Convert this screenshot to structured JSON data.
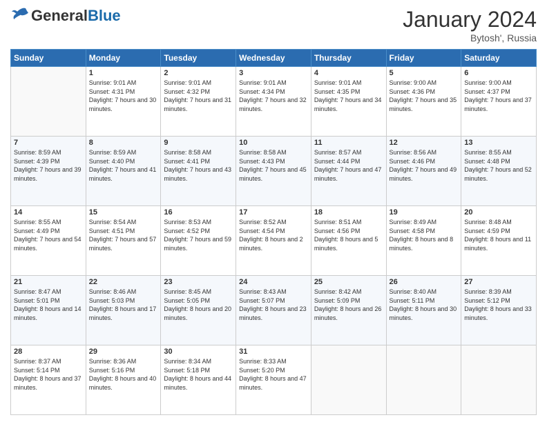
{
  "header": {
    "logo_general": "General",
    "logo_blue": "Blue",
    "month_year": "January 2024",
    "location": "Bytosh', Russia"
  },
  "weekdays": [
    "Sunday",
    "Monday",
    "Tuesday",
    "Wednesday",
    "Thursday",
    "Friday",
    "Saturday"
  ],
  "weeks": [
    [
      {
        "day": "",
        "sunrise": "",
        "sunset": "",
        "daylight": ""
      },
      {
        "day": "1",
        "sunrise": "9:01 AM",
        "sunset": "4:31 PM",
        "daylight": "7 hours and 30 minutes."
      },
      {
        "day": "2",
        "sunrise": "9:01 AM",
        "sunset": "4:32 PM",
        "daylight": "7 hours and 31 minutes."
      },
      {
        "day": "3",
        "sunrise": "9:01 AM",
        "sunset": "4:34 PM",
        "daylight": "7 hours and 32 minutes."
      },
      {
        "day": "4",
        "sunrise": "9:01 AM",
        "sunset": "4:35 PM",
        "daylight": "7 hours and 34 minutes."
      },
      {
        "day": "5",
        "sunrise": "9:00 AM",
        "sunset": "4:36 PM",
        "daylight": "7 hours and 35 minutes."
      },
      {
        "day": "6",
        "sunrise": "9:00 AM",
        "sunset": "4:37 PM",
        "daylight": "7 hours and 37 minutes."
      }
    ],
    [
      {
        "day": "7",
        "sunrise": "8:59 AM",
        "sunset": "4:39 PM",
        "daylight": "7 hours and 39 minutes."
      },
      {
        "day": "8",
        "sunrise": "8:59 AM",
        "sunset": "4:40 PM",
        "daylight": "7 hours and 41 minutes."
      },
      {
        "day": "9",
        "sunrise": "8:58 AM",
        "sunset": "4:41 PM",
        "daylight": "7 hours and 43 minutes."
      },
      {
        "day": "10",
        "sunrise": "8:58 AM",
        "sunset": "4:43 PM",
        "daylight": "7 hours and 45 minutes."
      },
      {
        "day": "11",
        "sunrise": "8:57 AM",
        "sunset": "4:44 PM",
        "daylight": "7 hours and 47 minutes."
      },
      {
        "day": "12",
        "sunrise": "8:56 AM",
        "sunset": "4:46 PM",
        "daylight": "7 hours and 49 minutes."
      },
      {
        "day": "13",
        "sunrise": "8:55 AM",
        "sunset": "4:48 PM",
        "daylight": "7 hours and 52 minutes."
      }
    ],
    [
      {
        "day": "14",
        "sunrise": "8:55 AM",
        "sunset": "4:49 PM",
        "daylight": "7 hours and 54 minutes."
      },
      {
        "day": "15",
        "sunrise": "8:54 AM",
        "sunset": "4:51 PM",
        "daylight": "7 hours and 57 minutes."
      },
      {
        "day": "16",
        "sunrise": "8:53 AM",
        "sunset": "4:52 PM",
        "daylight": "7 hours and 59 minutes."
      },
      {
        "day": "17",
        "sunrise": "8:52 AM",
        "sunset": "4:54 PM",
        "daylight": "8 hours and 2 minutes."
      },
      {
        "day": "18",
        "sunrise": "8:51 AM",
        "sunset": "4:56 PM",
        "daylight": "8 hours and 5 minutes."
      },
      {
        "day": "19",
        "sunrise": "8:49 AM",
        "sunset": "4:58 PM",
        "daylight": "8 hours and 8 minutes."
      },
      {
        "day": "20",
        "sunrise": "8:48 AM",
        "sunset": "4:59 PM",
        "daylight": "8 hours and 11 minutes."
      }
    ],
    [
      {
        "day": "21",
        "sunrise": "8:47 AM",
        "sunset": "5:01 PM",
        "daylight": "8 hours and 14 minutes."
      },
      {
        "day": "22",
        "sunrise": "8:46 AM",
        "sunset": "5:03 PM",
        "daylight": "8 hours and 17 minutes."
      },
      {
        "day": "23",
        "sunrise": "8:45 AM",
        "sunset": "5:05 PM",
        "daylight": "8 hours and 20 minutes."
      },
      {
        "day": "24",
        "sunrise": "8:43 AM",
        "sunset": "5:07 PM",
        "daylight": "8 hours and 23 minutes."
      },
      {
        "day": "25",
        "sunrise": "8:42 AM",
        "sunset": "5:09 PM",
        "daylight": "8 hours and 26 minutes."
      },
      {
        "day": "26",
        "sunrise": "8:40 AM",
        "sunset": "5:11 PM",
        "daylight": "8 hours and 30 minutes."
      },
      {
        "day": "27",
        "sunrise": "8:39 AM",
        "sunset": "5:12 PM",
        "daylight": "8 hours and 33 minutes."
      }
    ],
    [
      {
        "day": "28",
        "sunrise": "8:37 AM",
        "sunset": "5:14 PM",
        "daylight": "8 hours and 37 minutes."
      },
      {
        "day": "29",
        "sunrise": "8:36 AM",
        "sunset": "5:16 PM",
        "daylight": "8 hours and 40 minutes."
      },
      {
        "day": "30",
        "sunrise": "8:34 AM",
        "sunset": "5:18 PM",
        "daylight": "8 hours and 44 minutes."
      },
      {
        "day": "31",
        "sunrise": "8:33 AM",
        "sunset": "5:20 PM",
        "daylight": "8 hours and 47 minutes."
      },
      {
        "day": "",
        "sunrise": "",
        "sunset": "",
        "daylight": ""
      },
      {
        "day": "",
        "sunrise": "",
        "sunset": "",
        "daylight": ""
      },
      {
        "day": "",
        "sunrise": "",
        "sunset": "",
        "daylight": ""
      }
    ]
  ],
  "labels": {
    "sunrise": "Sunrise:",
    "sunset": "Sunset:",
    "daylight": "Daylight:"
  }
}
